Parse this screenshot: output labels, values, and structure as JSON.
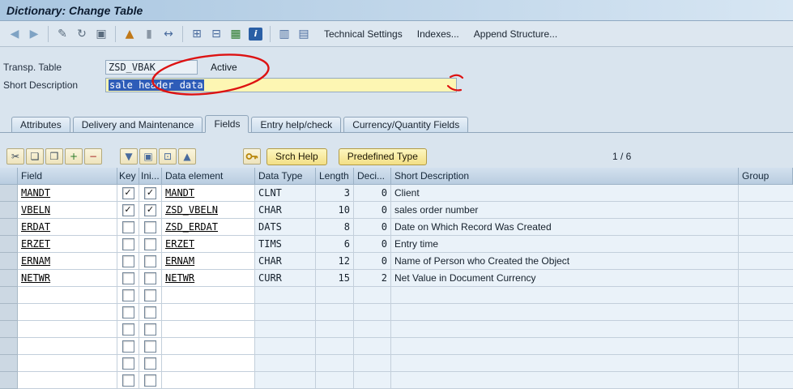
{
  "window": {
    "title": "Dictionary: Change Table"
  },
  "toolbar": {
    "icons": [
      {
        "name": "back-icon",
        "glyph": "◀",
        "color": "#7fa3c4"
      },
      {
        "name": "forward-icon",
        "glyph": "▶",
        "color": "#7fa3c4"
      },
      {
        "sep": true
      },
      {
        "name": "display-change-icon",
        "glyph": "✎",
        "color": "#5a6c7e"
      },
      {
        "name": "refresh-icon",
        "glyph": "↻",
        "color": "#5a6c7e"
      },
      {
        "name": "copy-object-icon",
        "glyph": "▣",
        "color": "#5a6c7e"
      },
      {
        "sep": true
      },
      {
        "name": "activate-icon",
        "glyph": "▲",
        "color": "#c07818"
      },
      {
        "name": "insert-element-icon",
        "glyph": "▮",
        "color": "#8a97a5"
      },
      {
        "name": "where-used-icon",
        "glyph": "↔",
        "color": "#4a6c9e"
      },
      {
        "sep": true
      },
      {
        "name": "hierarchy-icon",
        "glyph": "⊞",
        "color": "#4a6c9e"
      },
      {
        "name": "runtime-object-icon",
        "glyph": "⊟",
        "color": "#4a6c9e"
      },
      {
        "name": "table-contents-icon",
        "glyph": "▦",
        "color": "#2a7a2a"
      },
      {
        "name": "info-icon",
        "glyph": "i",
        "bg": "#2a5fa5",
        "fg": "#ffffff"
      },
      {
        "sep": true
      },
      {
        "name": "database-utility-icon",
        "glyph": "▥",
        "color": "#4a6c9e"
      },
      {
        "name": "index-table-icon",
        "glyph": "▤",
        "color": "#4a6c9e"
      }
    ],
    "buttons": [
      "Technical Settings",
      "Indexes...",
      "Append Structure..."
    ]
  },
  "form": {
    "transp_table_label": "Transp. Table",
    "transp_table_value": "ZSD_VBAK",
    "status": "Active",
    "short_desc_label": "Short Description",
    "short_desc_value": "sale header data"
  },
  "tabs": [
    {
      "label": "Attributes",
      "active": false
    },
    {
      "label": "Delivery and Maintenance",
      "active": false
    },
    {
      "label": "Fields",
      "active": true
    },
    {
      "label": "Entry help/check",
      "active": false
    },
    {
      "label": "Currency/Quantity Fields",
      "active": false
    }
  ],
  "grid_toolbar": {
    "groups": [
      [
        {
          "name": "cut-icon",
          "glyph": "✂",
          "color": "#3a4a5a"
        },
        {
          "name": "copy-icon",
          "glyph": "❏",
          "color": "#3a4a5a"
        },
        {
          "name": "paste-icon",
          "glyph": "❒",
          "color": "#3a4a5a"
        },
        {
          "name": "insert-row-icon",
          "glyph": "+",
          "color": "#2a7a2a"
        },
        {
          "name": "delete-row-icon",
          "glyph": "−",
          "color": "#aa2a2a"
        }
      ],
      [
        {
          "name": "move-down-icon",
          "glyph": "▼",
          "color": "#4a6c9e"
        },
        {
          "name": "select-all-icon",
          "glyph": "▣",
          "color": "#4a6c9e"
        },
        {
          "name": "expand-icon",
          "glyph": "⊡",
          "color": "#4a6c9e"
        },
        {
          "name": "move-up-icon",
          "glyph": "▲",
          "color": "#4a6c9e"
        }
      ],
      [
        {
          "name": "key-icon",
          "svg": "key"
        }
      ]
    ],
    "buttons": [
      "Srch Help",
      "Predefined Type"
    ],
    "pagination": "1 / 6"
  },
  "table": {
    "columns": [
      "Field",
      "Key",
      "Ini...",
      "Data element",
      "Data Type",
      "Length",
      "Deci...",
      "Short Description",
      "Group"
    ],
    "rows": [
      {
        "field": "MANDT",
        "key": true,
        "ini": true,
        "data_element": "MANDT",
        "data_type": "CLNT",
        "length": "3",
        "deci": "0",
        "short_description": "Client",
        "group": ""
      },
      {
        "field": "VBELN",
        "key": true,
        "ini": true,
        "data_element": "ZSD_VBELN",
        "data_type": "CHAR",
        "length": "10",
        "deci": "0",
        "short_description": "sales order number",
        "group": ""
      },
      {
        "field": "ERDAT",
        "key": false,
        "ini": false,
        "data_element": "ZSD_ERDAT",
        "data_type": "DATS",
        "length": "8",
        "deci": "0",
        "short_description": "Date on Which Record Was Created",
        "group": ""
      },
      {
        "field": "ERZET",
        "key": false,
        "ini": false,
        "data_element": "ERZET",
        "data_type": "TIMS",
        "length": "6",
        "deci": "0",
        "short_description": "Entry time",
        "group": ""
      },
      {
        "field": "ERNAM",
        "key": false,
        "ini": false,
        "data_element": "ERNAM",
        "data_type": "CHAR",
        "length": "12",
        "deci": "0",
        "short_description": "Name of Person who Created the Object",
        "group": ""
      },
      {
        "field": "NETWR",
        "key": false,
        "ini": false,
        "data_element": "NETWR",
        "data_type": "CURR",
        "length": "15",
        "deci": "2",
        "short_description": "Net Value in Document Currency",
        "group": ""
      }
    ],
    "empty_row_count": 6
  },
  "annotation": {
    "color": "#dd1212"
  }
}
